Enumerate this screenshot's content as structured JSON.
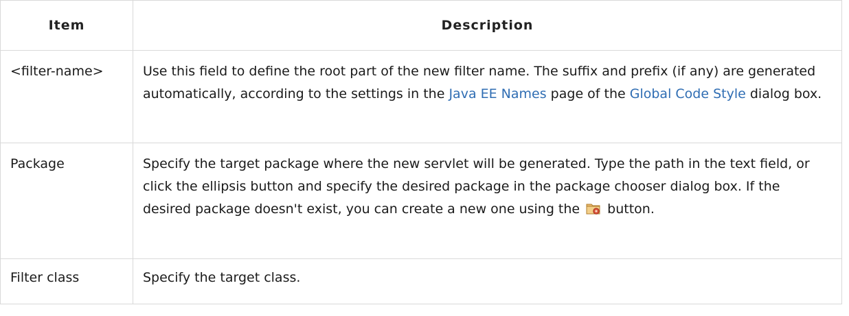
{
  "table": {
    "headers": {
      "item": "Item",
      "description": "Description"
    },
    "rows": [
      {
        "item": "<filter-name>",
        "description": {
          "text1": "Use this field to define the root part of the new filter name. The suffix and prefix (if any) are generated automatically, according to the settings in the ",
          "link1": "Java EE Names",
          "text2": " page of the ",
          "link2": "Global Code Style",
          "text3": " dialog box."
        }
      },
      {
        "item": "Package",
        "description": {
          "text1": "Specify the target package where the new servlet will be generated. Type the path in the text field, or click the ellipsis button and specify the desired package in the package chooser dialog box. If the desired package doesn't exist, you can create a new one using the ",
          "icon": "new-package-icon",
          "text2": " button."
        }
      },
      {
        "item": "Filter class",
        "description": {
          "text1": "Specify the target class."
        }
      }
    ]
  },
  "colors": {
    "link": "#2f6db3",
    "border": "#d9d9d9"
  }
}
